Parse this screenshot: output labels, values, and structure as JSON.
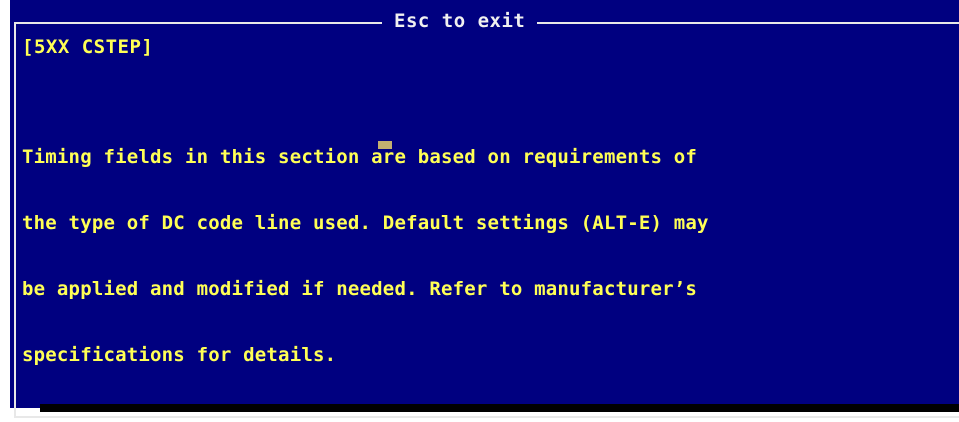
{
  "window": {
    "title": "Esc to exit"
  },
  "section": {
    "header": "[5XX CSTEP]",
    "lines": [
      "Timing fields in this section are based on requirements of",
      "the type of DC code line used. Default settings (ALT-E) may",
      "be applied and modified if needed. Refer to manufacturer’s",
      "specifications for details."
    ]
  },
  "colors": {
    "background": "#000080",
    "text": "#ffff55",
    "title": "#f0f0f0",
    "border": "#e8e8e8"
  }
}
